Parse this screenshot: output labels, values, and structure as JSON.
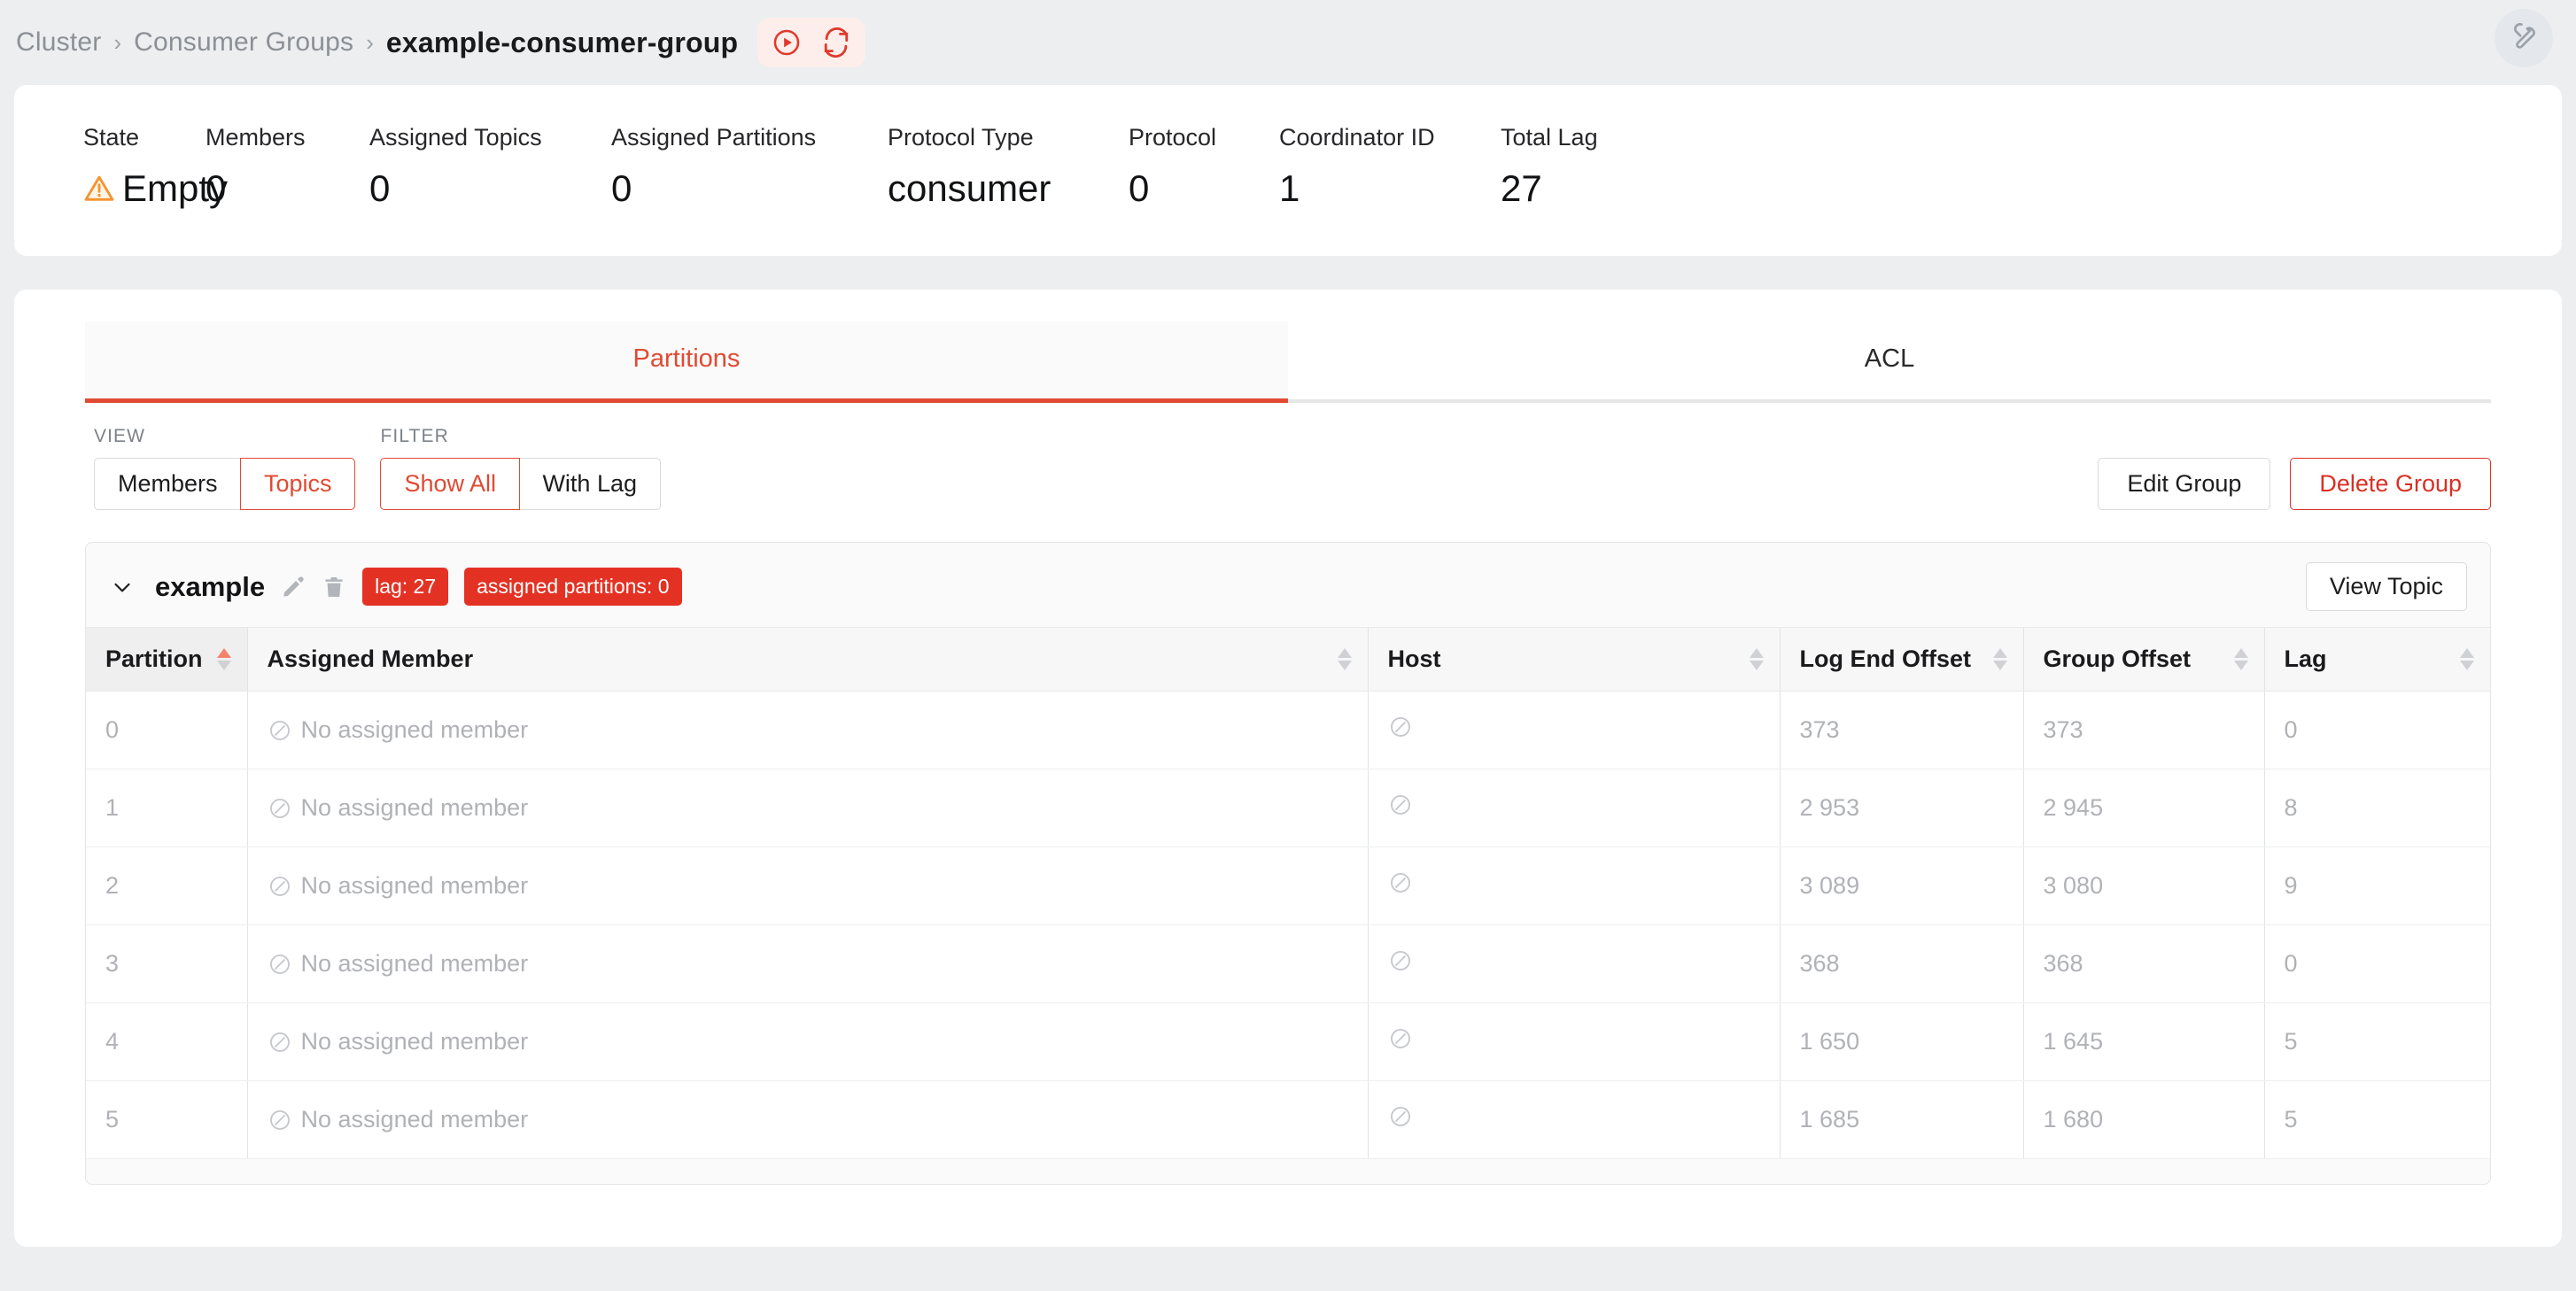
{
  "breadcrumb": {
    "items": [
      "Cluster",
      "Consumer Groups"
    ],
    "current": "example-consumer-group",
    "separator": "›",
    "actions": [
      {
        "name": "play-circle-icon",
        "label": "Reset Offsets"
      },
      {
        "name": "refresh-icon",
        "label": "Refresh"
      }
    ],
    "tools_icon": "wrench-icon"
  },
  "stats": [
    {
      "label": "State",
      "value": "Empty",
      "icon": "warning-triangle-icon"
    },
    {
      "label": "Members",
      "value": "0"
    },
    {
      "label": "Assigned Topics",
      "value": "0"
    },
    {
      "label": "Assigned Partitions",
      "value": "0"
    },
    {
      "label": "Protocol Type",
      "value": "consumer"
    },
    {
      "label": "Protocol",
      "value": "0"
    },
    {
      "label": "Coordinator ID",
      "value": "1"
    },
    {
      "label": "Total Lag",
      "value": "27"
    }
  ],
  "tabs": [
    {
      "label": "Partitions",
      "active": true
    },
    {
      "label": "ACL",
      "active": false
    }
  ],
  "controls": {
    "view_legend": "VIEW",
    "filter_legend": "FILTER",
    "view_options": [
      {
        "label": "Members",
        "selected": false
      },
      {
        "label": "Topics",
        "selected": true
      }
    ],
    "filter_options": [
      {
        "label": "Show All",
        "selected": true
      },
      {
        "label": "With Lag",
        "selected": false
      }
    ],
    "edit_group_label": "Edit Group",
    "delete_group_label": "Delete Group"
  },
  "topic": {
    "name": "example",
    "edit_icon": "pencil-icon",
    "delete_icon": "trash-icon",
    "collapse_icon": "chevron-down-icon",
    "badges": [
      "lag: 27",
      "assigned partitions: 0"
    ],
    "view_topic_label": "View Topic"
  },
  "table": {
    "columns": [
      {
        "label": "Partition",
        "sort": "asc"
      },
      {
        "label": "Assigned Member",
        "sort": "none"
      },
      {
        "label": "Host",
        "sort": "none"
      },
      {
        "label": "Log End Offset",
        "sort": "none"
      },
      {
        "label": "Group Offset",
        "sort": "none"
      },
      {
        "label": "Lag",
        "sort": "none"
      }
    ],
    "empty_member_text": "No assigned member",
    "empty_member_icon": "circle-slash-icon",
    "empty_host_icon": "circle-slash-icon",
    "rows": [
      {
        "partition": "0",
        "member": "No assigned member",
        "host": "",
        "log_end_offset": "373",
        "group_offset": "373",
        "lag": "0"
      },
      {
        "partition": "1",
        "member": "No assigned member",
        "host": "",
        "log_end_offset": "2 953",
        "group_offset": "2 945",
        "lag": "8"
      },
      {
        "partition": "2",
        "member": "No assigned member",
        "host": "",
        "log_end_offset": "3 089",
        "group_offset": "3 080",
        "lag": "9"
      },
      {
        "partition": "3",
        "member": "No assigned member",
        "host": "",
        "log_end_offset": "368",
        "group_offset": "368",
        "lag": "0"
      },
      {
        "partition": "4",
        "member": "No assigned member",
        "host": "",
        "log_end_offset": "1 650",
        "group_offset": "1 645",
        "lag": "5"
      },
      {
        "partition": "5",
        "member": "No assigned member",
        "host": "",
        "log_end_offset": "1 685",
        "group_offset": "1 680",
        "lag": "5"
      }
    ]
  },
  "colors": {
    "accent_red": "#e04a33",
    "badge_red": "#e33224",
    "danger_red": "#d93025",
    "warning_orange": "#f59331",
    "page_bg": "#eceef0"
  }
}
